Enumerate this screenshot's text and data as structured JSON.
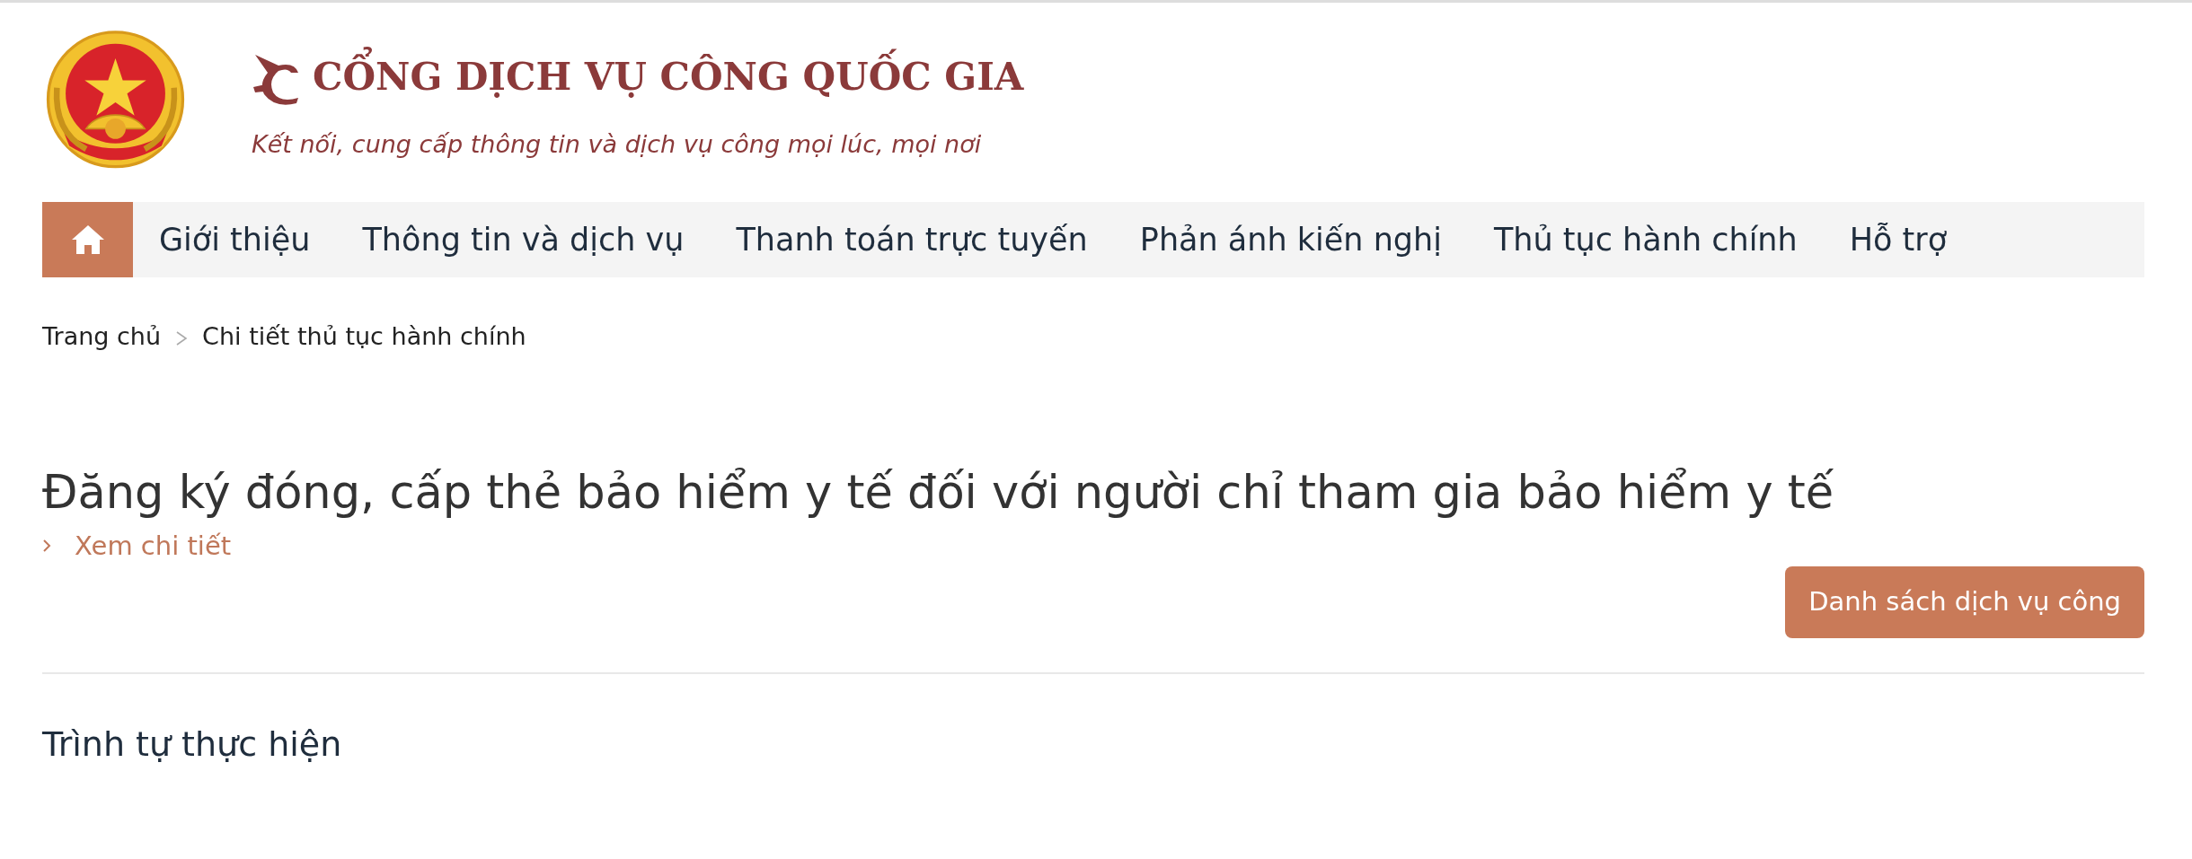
{
  "header": {
    "title": "CỔNG DỊCH VỤ CÔNG QUỐC GIA",
    "slogan": "Kết nối, cung cấp thông tin và dịch vụ công mọi lúc, mọi nơi"
  },
  "nav": {
    "home_selected": true,
    "items": [
      {
        "label": "Giới thiệu",
        "selected": false
      },
      {
        "label": "Thông tin và dịch vụ",
        "selected": false
      },
      {
        "label": "Thanh toán trực tuyến",
        "selected": false
      },
      {
        "label": "Phản ánh kiến nghị",
        "selected": false
      },
      {
        "label": "Thủ tục hành chính",
        "selected": false
      },
      {
        "label": "Hỗ trợ",
        "selected": false
      }
    ]
  },
  "breadcrumb": [
    {
      "label": "Trang chủ"
    },
    {
      "label": "Chi tiết thủ tục hành chính"
    }
  ],
  "procedure": {
    "title": "Đăng ký đóng, cấp thẻ bảo hiểm y tế đối với người chỉ tham gia bảo hiểm y tế",
    "details_link": "Xem chi tiết",
    "button": "Danh sách dịch vụ công"
  },
  "section": {
    "title": "Trình tự thực hiện"
  }
}
